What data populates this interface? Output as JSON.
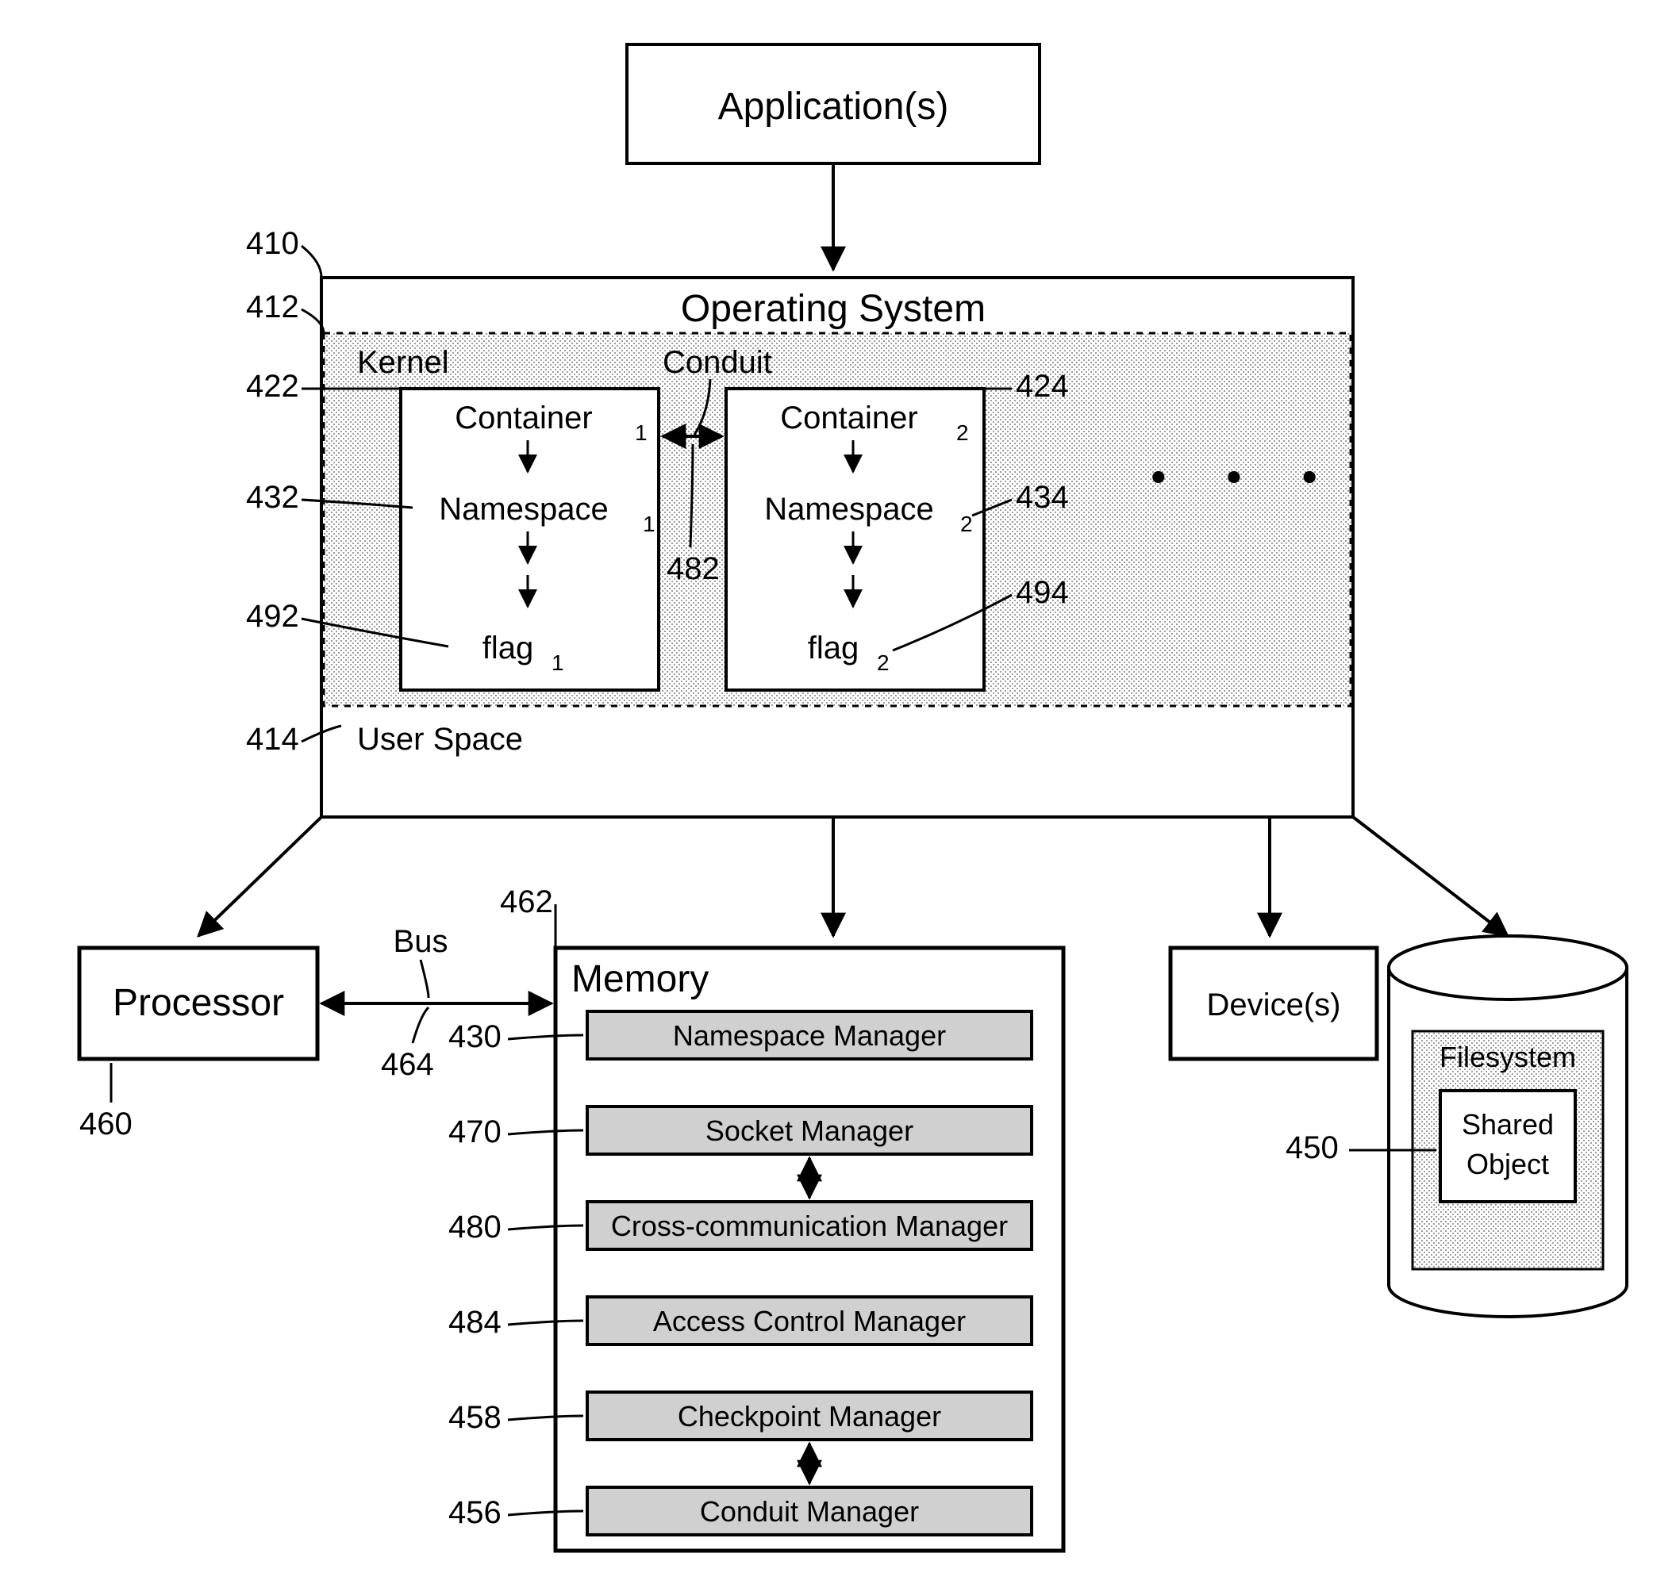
{
  "applications": "Application(s)",
  "os": {
    "title": "Operating System",
    "kernel": "Kernel",
    "conduit": "Conduit",
    "userspace": "User Space",
    "container1": {
      "name": "Container",
      "sub": "1"
    },
    "namespace1": {
      "name": "Namespace",
      "sub": "1"
    },
    "flag1": {
      "name": "flag",
      "sub": "1"
    },
    "container2": {
      "name": "Container",
      "sub": "2"
    },
    "namespace2": {
      "name": "Namespace",
      "sub": "2"
    },
    "flag2": {
      "name": "flag",
      "sub": "2"
    },
    "dots": "•   •   •"
  },
  "processor": "Processor",
  "bus": "Bus",
  "memory": {
    "title": "Memory",
    "items": [
      "Namespace Manager",
      "Socket Manager",
      "Cross-communication Manager",
      "Access Control Manager",
      "Checkpoint Manager",
      "Conduit Manager"
    ]
  },
  "devices": "Device(s)",
  "filesystem": {
    "title": "Filesystem",
    "shared": "Shared",
    "object": "Object"
  },
  "refs": {
    "r410": "410",
    "r412": "412",
    "r414": "414",
    "r422": "422",
    "r424": "424",
    "r430": "430",
    "r432": "432",
    "r434": "434",
    "r450": "450",
    "r456": "456",
    "r458": "458",
    "r460": "460",
    "r462": "462",
    "r464": "464",
    "r470": "470",
    "r480": "480",
    "r482": "482",
    "r484": "484",
    "r492": "492",
    "r494": "494"
  }
}
